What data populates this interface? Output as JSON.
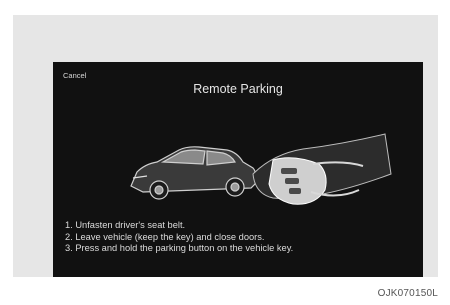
{
  "screen": {
    "cancel_label": "Cancel",
    "title": "Remote Parking",
    "illustration_icons": [
      "car-icon",
      "hand-holding-key-icon"
    ],
    "steps": [
      "1. Unfasten driver's seat belt.",
      "2. Leave vehicle (keep the key) and close doors.",
      "3. Press and hold the parking button on the vehicle key."
    ]
  },
  "figure": {
    "code": "OJK070150L"
  },
  "colors": {
    "screen_bg": "#111111",
    "frame_bg": "#e6e6e6",
    "text": "#dcdcdc"
  }
}
